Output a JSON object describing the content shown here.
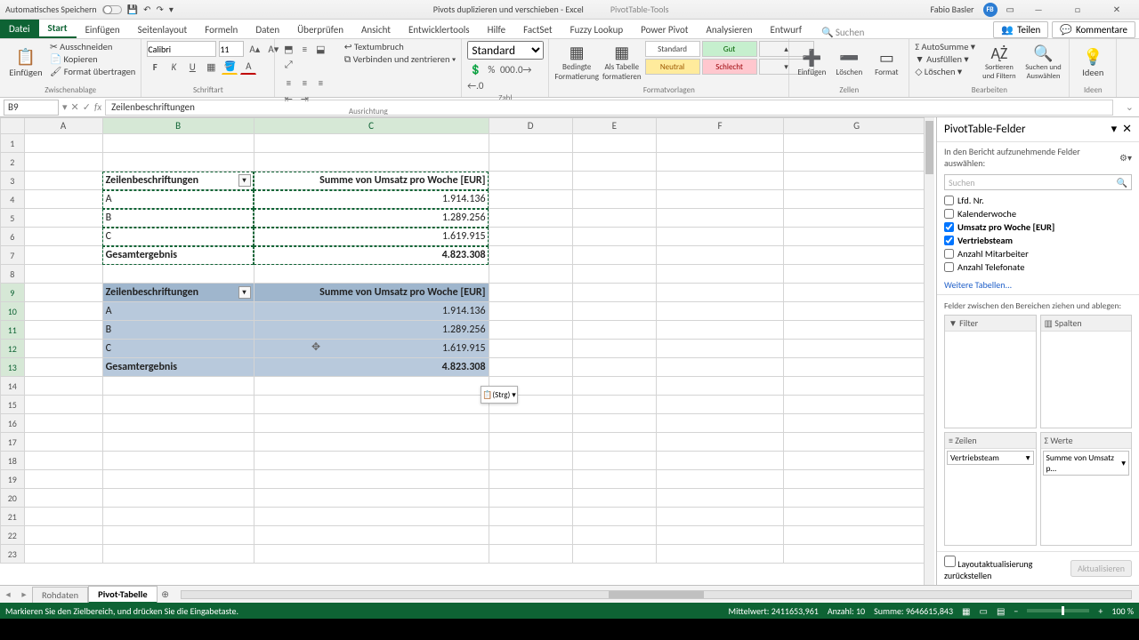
{
  "titlebar": {
    "autosave": "Automatisches Speichern",
    "center_doc": "Pivots duplizieren und verschieben  -  Excel",
    "context_tools": "PivotTable-Tools",
    "user": "Fabio Basler",
    "user_initials": "FB"
  },
  "tabs": {
    "file": "Datei",
    "list": [
      "Start",
      "Einfügen",
      "Seitenlayout",
      "Formeln",
      "Daten",
      "Überprüfen",
      "Ansicht",
      "Entwicklertools",
      "Hilfe",
      "FactSet",
      "Fuzzy Lookup",
      "Power Pivot",
      "Analysieren",
      "Entwurf"
    ],
    "search": "Suchen",
    "share": "Teilen",
    "comments": "Kommentare"
  },
  "ribbon": {
    "clipboard": {
      "paste": "Einfügen",
      "cut": "Ausschneiden",
      "copy": "Kopieren",
      "format": "Format übertragen",
      "label": "Zwischenablage"
    },
    "font": {
      "name": "Calibri",
      "size": "11",
      "label": "Schriftart"
    },
    "align": {
      "wrap": "Textumbruch",
      "merge": "Verbinden und zentrieren",
      "label": "Ausrichtung"
    },
    "number": {
      "format": "Standard",
      "label": "Zahl"
    },
    "styles": {
      "cond": "Bedingte Formatierung",
      "table": "Als Tabelle formatieren",
      "standard": "Standard",
      "gut": "Gut",
      "neutral": "Neutral",
      "schlecht": "Schlecht",
      "label": "Formatvorlagen"
    },
    "cells": {
      "insert": "Einfügen",
      "delete": "Löschen",
      "format": "Format",
      "label": "Zellen"
    },
    "editing": {
      "sum": "AutoSumme",
      "fill": "Ausfüllen",
      "clear": "Löschen",
      "sort": "Sortieren und Filtern",
      "find": "Suchen und Auswählen",
      "label": "Bearbeiten"
    },
    "ideas": {
      "btn": "Ideen",
      "label": "Ideen"
    }
  },
  "formula": {
    "ref": "B9",
    "value": "Zeilenbeschriftungen"
  },
  "columns": [
    "A",
    "B",
    "C",
    "D",
    "E",
    "F",
    "G"
  ],
  "pivot": {
    "col1": "Zeilenbeschriftungen",
    "col2": "Summe von Umsatz pro Woche [EUR]",
    "rows": [
      {
        "k": "A",
        "v": "1.914.136"
      },
      {
        "k": "B",
        "v": "1.289.256"
      },
      {
        "k": "C",
        "v": "1.619.915"
      }
    ],
    "total_label": "Gesamtergebnis",
    "total_value": "4.823.308"
  },
  "paste_badge": "(Strg) ▾",
  "pane": {
    "title": "PivotTable-Felder",
    "subtitle": "In den Bericht aufzunehmende Felder auswählen:",
    "search": "Suchen",
    "fields": [
      {
        "name": "Lfd. Nr.",
        "checked": false
      },
      {
        "name": "Kalenderwoche",
        "checked": false
      },
      {
        "name": "Umsatz pro Woche [EUR]",
        "checked": true
      },
      {
        "name": "Vertriebsteam",
        "checked": true
      },
      {
        "name": "Anzahl Mitarbeiter",
        "checked": false
      },
      {
        "name": "Anzahl Telefonate",
        "checked": false
      }
    ],
    "more": "Weitere Tabellen...",
    "drag_hint": "Felder zwischen den Bereichen ziehen und ablegen:",
    "areas": {
      "filter": "Filter",
      "columns": "Spalten",
      "rows": "Zeilen",
      "values": "Werte"
    },
    "row_item": "Vertriebsteam",
    "value_item": "Summe von Umsatz p…",
    "defer": "Layoutaktualisierung zurückstellen",
    "update": "Aktualisieren"
  },
  "sheettabs": {
    "t1": "Rohdaten",
    "t2": "Pivot-Tabelle"
  },
  "status": {
    "left": "Markieren Sie den Zielbereich, und drücken Sie die Eingabetaste.",
    "avg": "Mittelwert: 2411653,961",
    "count": "Anzahl: 10",
    "sum": "Summe: 9646615,843",
    "zoom": "100 %"
  }
}
